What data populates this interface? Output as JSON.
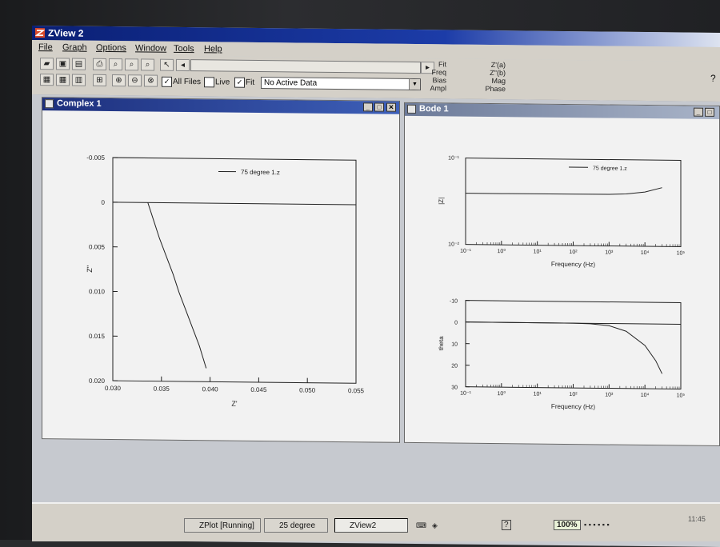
{
  "app": {
    "title": "ZView 2"
  },
  "menu": [
    "File",
    "Graph",
    "Options",
    "Window",
    "Tools",
    "Help"
  ],
  "toolbar": {
    "all_files_label": "All Files",
    "all_files_checked": true,
    "live_label": "Live",
    "live_checked": false,
    "fit_label": "Fit",
    "fit_checked": true,
    "data_select": "No Active Data",
    "right_labels_left": [
      "Fit",
      "Freq",
      "Bias",
      "Ampl"
    ],
    "right_labels_right": [
      "Z'(a)",
      "Z''(b)",
      "Mag",
      "Phase"
    ],
    "help_icon": "?"
  },
  "complex_window": {
    "title": "Complex 1",
    "chart_data": {
      "type": "line",
      "legend": "75 degree 1.z",
      "xlabel": "Z'",
      "ylabel": "Z''",
      "xlim": [
        0.03,
        0.055
      ],
      "ylim": [
        0.02,
        -0.005
      ],
      "x_ticks": [
        "0.030",
        "0.035",
        "0.040",
        "0.045",
        "0.050",
        "0.055"
      ],
      "y_ticks": [
        "-0.005",
        "0",
        "0.005",
        "0.010",
        "0.015",
        "0.020"
      ],
      "series": [
        {
          "name": "75 degree 1.z",
          "x": [
            0.0336,
            0.0342,
            0.0348,
            0.0355,
            0.0362,
            0.0368,
            0.0375,
            0.0382,
            0.0389,
            0.0396
          ],
          "y": [
            0.0,
            0.002,
            0.004,
            0.006,
            0.008,
            0.01,
            0.012,
            0.014,
            0.016,
            0.0185
          ]
        }
      ]
    }
  },
  "bode_window": {
    "title": "Bode 1",
    "chart_data": [
      {
        "type": "line",
        "legend": "75 degree 1.z",
        "xlabel": "Frequency (Hz)",
        "ylabel": "|Z|",
        "x_ticks": [
          "10⁻¹",
          "10⁰",
          "10¹",
          "10²",
          "10³",
          "10⁴",
          "10⁵"
        ],
        "y_ticks": [
          "10⁻¹",
          "10⁻²"
        ],
        "xscale": "log",
        "xlim": [
          0.1,
          100000
        ],
        "yscale": "log",
        "ylim": [
          0.01,
          0.1
        ],
        "series": [
          {
            "name": "75 degree 1.z",
            "x": [
              0.1,
              1,
              10,
              100,
              1000,
              3000,
              10000,
              30000
            ],
            "y": [
              0.0392,
              0.0392,
              0.0393,
              0.0394,
              0.0396,
              0.0402,
              0.0425,
              0.048
            ]
          }
        ]
      },
      {
        "type": "line",
        "xlabel": "Frequency (Hz)",
        "ylabel": "theta",
        "x_ticks": [
          "10⁻¹",
          "10⁰",
          "10¹",
          "10²",
          "10³",
          "10⁴",
          "10⁵"
        ],
        "y_ticks": [
          "-10",
          "0",
          "10",
          "20",
          "30"
        ],
        "xscale": "log",
        "xlim": [
          0.1,
          100000
        ],
        "ylim": [
          30,
          -10
        ],
        "series": [
          {
            "name": "75 degree 1.z",
            "x": [
              0.1,
              1,
              10,
              100,
              300,
              1000,
              3000,
              10000,
              20000,
              30000
            ],
            "y": [
              0,
              0,
              0,
              0,
              0.2,
              1.0,
              3.5,
              10,
              17,
              23
            ]
          }
        ]
      }
    ]
  },
  "taskbar": {
    "tasks": [
      "ZPlot [Running]",
      "25 degree",
      "ZView2"
    ],
    "zoom": "100%",
    "clock": "11:45"
  }
}
